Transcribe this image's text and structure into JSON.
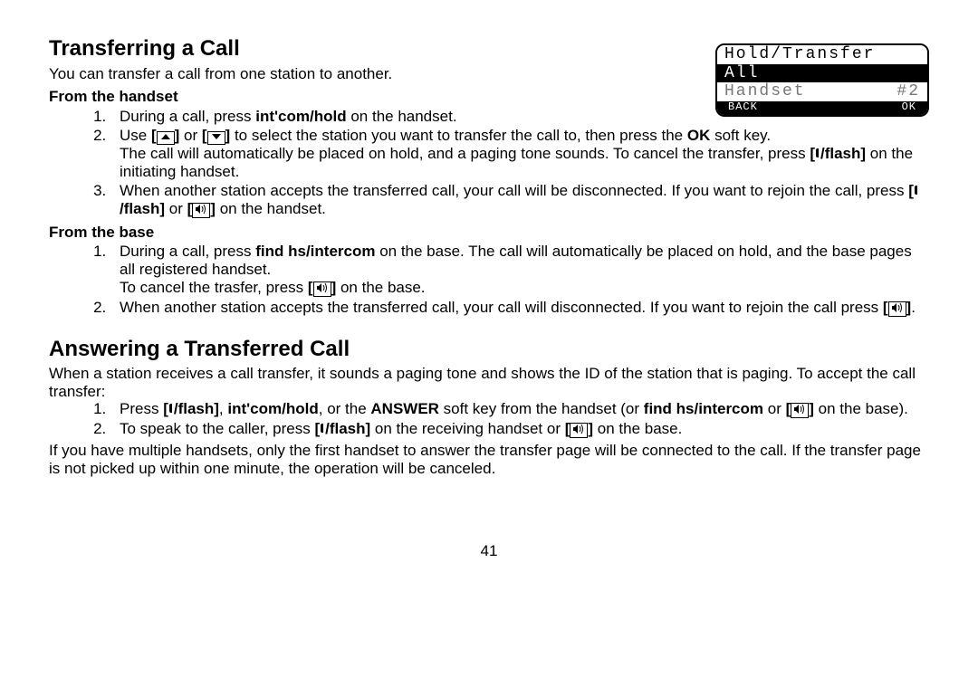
{
  "lcd": {
    "title": "Hold/Transfer",
    "row_sel": "All",
    "row_dim_left": "Handset",
    "row_dim_right": "#2",
    "soft_left": "BACK",
    "soft_right": "OK"
  },
  "h1": "Transferring a Call",
  "intro1": "You can transfer a call from one station to another.",
  "sub_handset": "From the handset",
  "hs1_a": "During a call, press ",
  "hs1_b": "int'com/hold",
  "hs1_c": " on the handset.",
  "hs2_a": "Use ",
  "hs2_b": " or ",
  "hs2_c": " to select the station you want to transfer the call to, then press the ",
  "hs2_ok": "OK",
  "hs2_d": " soft key.",
  "hs2_line2a": "The call will automatically be placed on hold, and a paging tone sounds. To cancel the transfer, press ",
  "hs2_flash": "/flash]",
  "hs2_line2b": " on the initiating handset.",
  "hs3_a": "When another station accepts the transferred call, your call will be disconnected. If you want to rejoin the call, press ",
  "hs3_or": " or ",
  "hs3_end": " on the handset.",
  "sub_base": "From the base",
  "bs1_a": "During a call, press ",
  "bs1_b": "find hs/intercom",
  "bs1_c": " on the base. The call will automatically be placed on hold, and the base pages all registered handset.",
  "bs1_line2a": "To cancel the trasfer, press ",
  "bs1_line2b": " on the base.",
  "bs2_a": "When another station accepts the transferred call, your call will disconnected. If you want to rejoin the call press ",
  "bs2_b": ".",
  "h2": "Answering a Transferred Call",
  "intro2": "When a station receives a call transfer, it sounds a paging tone and shows the ID of the station that is paging. To accept the call transfer:",
  "an1_a": "Press ",
  "an1_b": ", ",
  "an1_c": "int'com/hold",
  "an1_d": ",  or the ",
  "an1_e": "ANSWER",
  "an1_f": " soft key from the handset (or ",
  "an1_g": "find hs/intercom",
  "an1_h": " or ",
  "an1_i": " on the base).",
  "an2_a": "To speak to the caller, press ",
  "an2_b": " on the receiving handset or ",
  "an2_c": " on the base.",
  "outro": "If you have multiple handsets, only the first handset to answer the transfer page will be connected to the call. If the transfer page is not picked up within one minute, the operation will be canceled.",
  "page": "41",
  "bracket_open": "[",
  "bracket_close": "]"
}
